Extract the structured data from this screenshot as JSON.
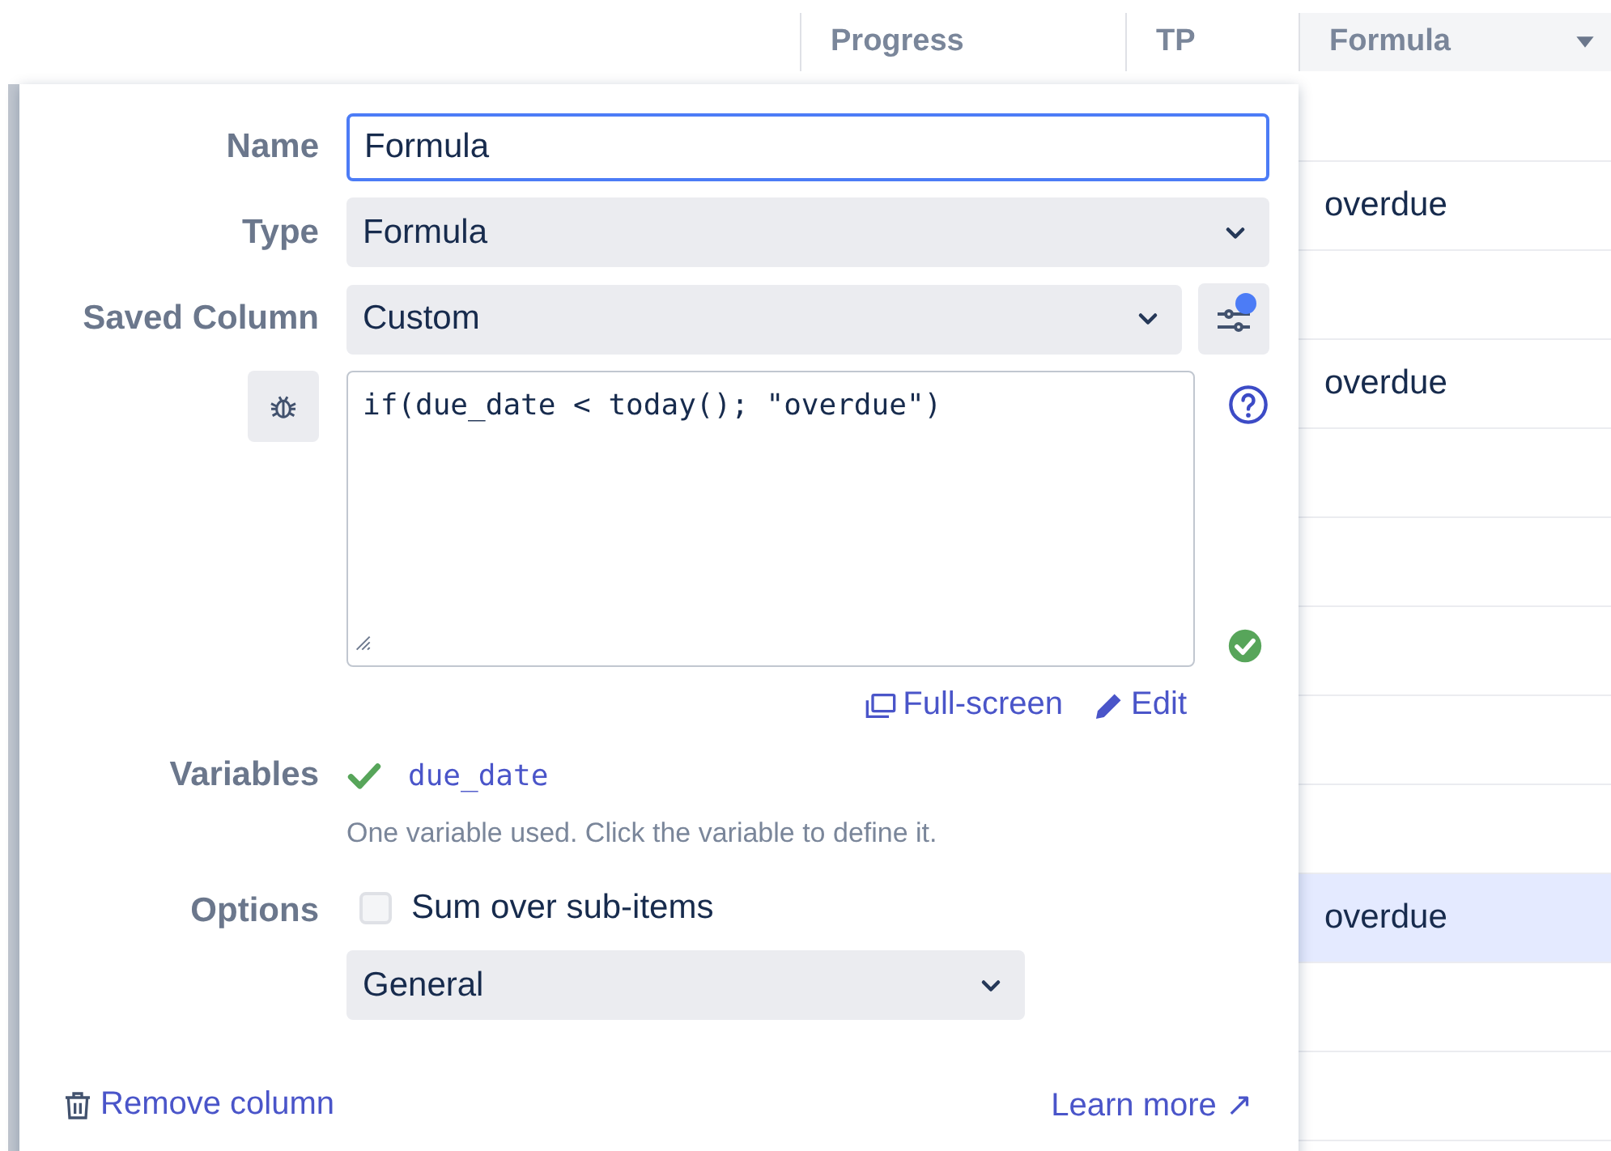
{
  "table": {
    "columns": [
      {
        "label": "Progress"
      },
      {
        "label": "TP"
      },
      {
        "label": "Formula"
      }
    ],
    "formula_cells": [
      {
        "selected": false
      },
      {
        "value": "overdue",
        "selected": false
      },
      {
        "selected": false
      },
      {
        "value": "overdue",
        "selected": false
      },
      {
        "selected": false
      },
      {
        "selected": false
      },
      {
        "selected": false
      },
      {
        "selected": false
      },
      {
        "selected": false
      },
      {
        "value": "overdue",
        "selected": true
      },
      {
        "selected": false
      },
      {
        "selected": false
      }
    ]
  },
  "column_editor": {
    "name": {
      "label": "Name",
      "value": "Formula",
      "focused": true
    },
    "type": {
      "label": "Type",
      "value": "Formula"
    },
    "saved_column": {
      "label": "Saved Column",
      "value": "Custom",
      "settings_indicator": true
    },
    "formula": {
      "code": "if(due_date < today(); \"overdue\")",
      "valid": true
    },
    "links": [
      {
        "label": "Full-screen",
        "kind": "fullscreen"
      },
      {
        "label": "Edit",
        "kind": "edit"
      }
    ],
    "variables": {
      "label": "Variables",
      "items": [
        {
          "name": "due_date",
          "defined": true
        }
      ],
      "hint": "One variable used. Click the variable to define it."
    },
    "options": {
      "label": "Options",
      "checkbox": {
        "label": "Sum over sub-items",
        "checked": false
      },
      "format": "General"
    },
    "footer": {
      "remove": "Remove column",
      "learn_more": "Learn more ↗"
    }
  }
}
